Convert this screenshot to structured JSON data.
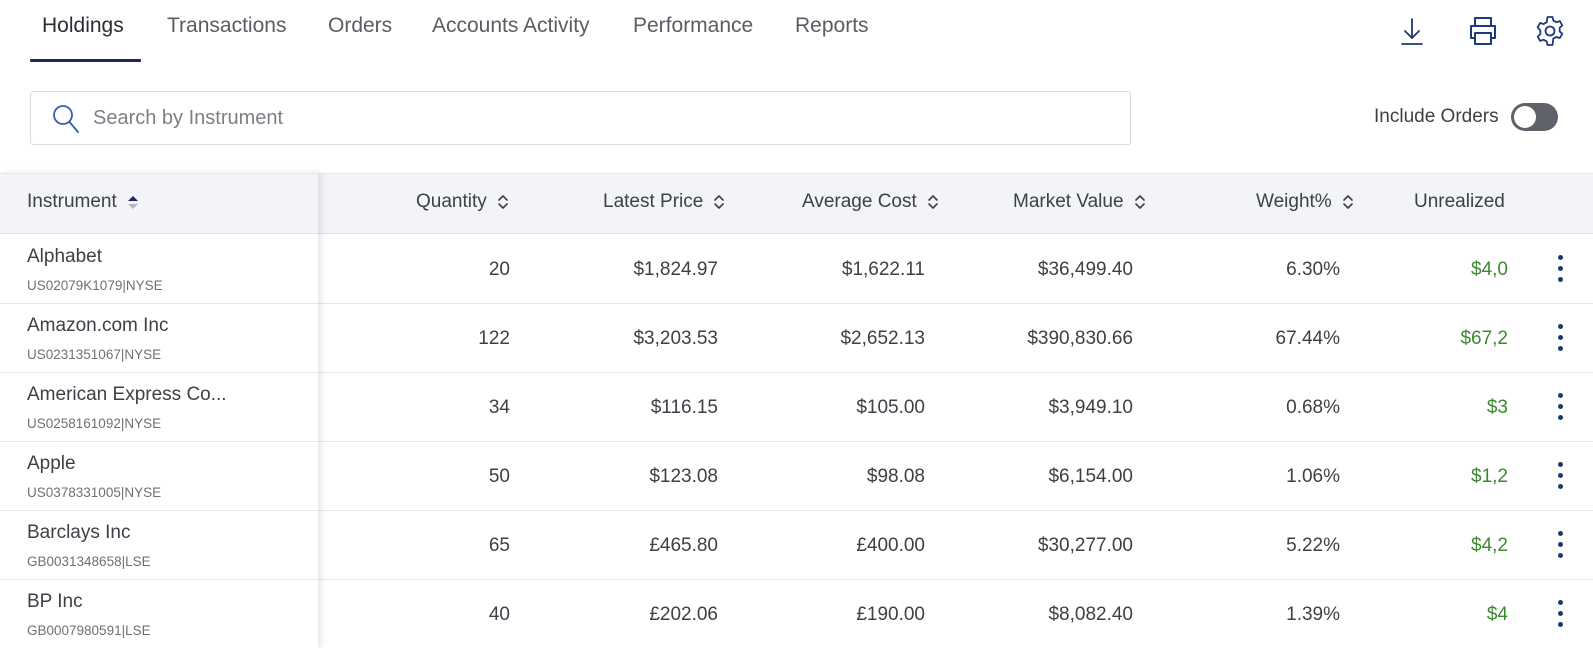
{
  "tabs": [
    {
      "label": "Holdings",
      "active": true
    },
    {
      "label": "Transactions",
      "active": false
    },
    {
      "label": "Orders",
      "active": false
    },
    {
      "label": "Accounts Activity",
      "active": false
    },
    {
      "label": "Performance",
      "active": false
    },
    {
      "label": "Reports",
      "active": false
    }
  ],
  "toolbar_icons": [
    "download-icon",
    "print-icon",
    "gear-icon"
  ],
  "search": {
    "placeholder": "Search by Instrument",
    "value": ""
  },
  "include_orders": {
    "label": "Include Orders",
    "on": false
  },
  "columns": {
    "instrument": "Instrument",
    "quantity": "Quantity",
    "latest_price": "Latest Price",
    "average_cost": "Average Cost",
    "market_value": "Market Value",
    "weight": "Weight%",
    "unrealized": "Unrealized"
  },
  "rows": [
    {
      "name": "Alphabet",
      "code": "US02079K1079|NYSE",
      "quantity": "20",
      "latest_price": "$1,824.97",
      "average_cost": "$1,622.11",
      "market_value": "$36,499.40",
      "weight": "6.30%",
      "unrealized": "$4,0"
    },
    {
      "name": "Amazon.com Inc",
      "code": "US0231351067|NYSE",
      "quantity": "122",
      "latest_price": "$3,203.53",
      "average_cost": "$2,652.13",
      "market_value": "$390,830.66",
      "weight": "67.44%",
      "unrealized": "$67,2"
    },
    {
      "name": "American Express Co...",
      "code": "US0258161092|NYSE",
      "quantity": "34",
      "latest_price": "$116.15",
      "average_cost": "$105.00",
      "market_value": "$3,949.10",
      "weight": "0.68%",
      "unrealized": "$3"
    },
    {
      "name": "Apple",
      "code": "US0378331005|NYSE",
      "quantity": "50",
      "latest_price": "$123.08",
      "average_cost": "$98.08",
      "market_value": "$6,154.00",
      "weight": "1.06%",
      "unrealized": "$1,2"
    },
    {
      "name": "Barclays Inc",
      "code": "GB0031348658|LSE",
      "quantity": "65",
      "latest_price": "£465.80",
      "average_cost": "£400.00",
      "market_value": "$30,277.00",
      "weight": "5.22%",
      "unrealized": "$4,2"
    },
    {
      "name": "BP Inc",
      "code": "GB0007980591|LSE",
      "quantity": "40",
      "latest_price": "£202.06",
      "average_cost": "£190.00",
      "market_value": "$8,082.40",
      "weight": "1.39%",
      "unrealized": "$4"
    }
  ],
  "colors": {
    "accent": "#1e2466",
    "positive": "#3c8a2e",
    "header_bg": "#f3f4f7",
    "kebab": "#1a3a6e"
  }
}
